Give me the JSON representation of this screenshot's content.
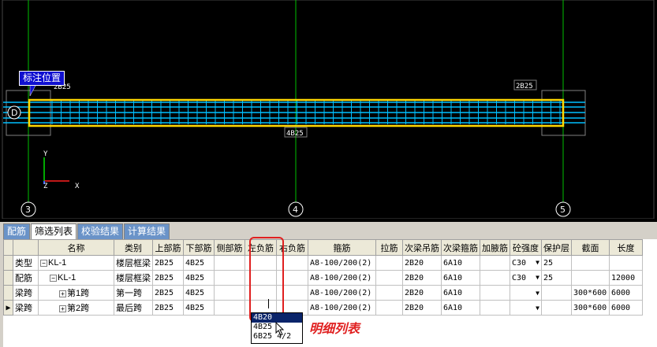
{
  "canvas": {
    "callout": "标注位置",
    "beam_labels": {
      "left_top": "2B25",
      "right_top": "2B25",
      "bottom": "4B25"
    },
    "axis_numbers": [
      "3",
      "4",
      "5"
    ],
    "row_axis": "D",
    "ucs": {
      "x": "X",
      "y": "Y",
      "z": "Z"
    }
  },
  "tabs": [
    "配筋",
    "筛选列表",
    "校验结果",
    "计算结果"
  ],
  "active_tab": 1,
  "table": {
    "headers": [
      "名称",
      "类别",
      "上部筋",
      "下部筋",
      "侧部筋",
      "左负筋",
      "右负筋",
      "箍筋",
      "拉筋",
      "次梁吊筋",
      "次梁箍筋",
      "加腋筋",
      "砼强度",
      "保护层",
      "截面",
      "长度"
    ],
    "rows": [
      {
        "type": "类型",
        "name": "KL-1",
        "tree": "⊟",
        "indent": 0,
        "category": "楼层框梁",
        "top": "2B25",
        "bottom": "4B25",
        "side": "",
        "left_neg": "",
        "right_neg": "",
        "stirrup": "A8-100/200(2)",
        "tie": "",
        "hanger": "2B20",
        "sec_stirrup": "6A10",
        "haunch": "",
        "concrete": "C30",
        "cover": "25",
        "section": "",
        "length": ""
      },
      {
        "type": "配筋",
        "name": "KL-1",
        "tree": "⊟",
        "indent": 1,
        "category": "楼层框梁",
        "top": "2B25",
        "bottom": "4B25",
        "side": "",
        "left_neg": "",
        "right_neg": "",
        "stirrup": "A8-100/200(2)",
        "tie": "",
        "hanger": "2B20",
        "sec_stirrup": "6A10",
        "haunch": "",
        "concrete": "C30",
        "cover": "25",
        "section": "",
        "length": "12000"
      },
      {
        "type": "梁跨",
        "name": "第1跨",
        "tree": "⊞",
        "indent": 2,
        "category": "第一跨",
        "top": "2B25",
        "bottom": "4B25",
        "side": "",
        "left_neg": "",
        "right_neg": "",
        "stirrup": "A8-100/200(2)",
        "tie": "",
        "hanger": "2B20",
        "sec_stirrup": "6A10",
        "haunch": "",
        "concrete": "",
        "cover": "",
        "section": "300*600",
        "length": "6000"
      },
      {
        "type": "梁跨",
        "name": "第2跨",
        "tree": "⊞",
        "indent": 2,
        "category": "最后跨",
        "top": "2B25",
        "bottom": "4B25",
        "side": "",
        "left_neg": "",
        "right_neg": "",
        "stirrup": "A8-100/200(2)",
        "tie": "",
        "hanger": "2B20",
        "sec_stirrup": "6A10",
        "haunch": "",
        "concrete": "",
        "cover": "",
        "section": "300*600",
        "length": "6000"
      }
    ]
  },
  "dropdown_options": [
    "4B20",
    "4B25",
    "6B25 4/2"
  ],
  "annotation": "明细列表",
  "colors": {
    "canvas_bg": "#000000",
    "grid_line": "#00c000",
    "beam": "#00bfff",
    "beam_outline": "#ffd700",
    "highlight": "#e02020"
  }
}
